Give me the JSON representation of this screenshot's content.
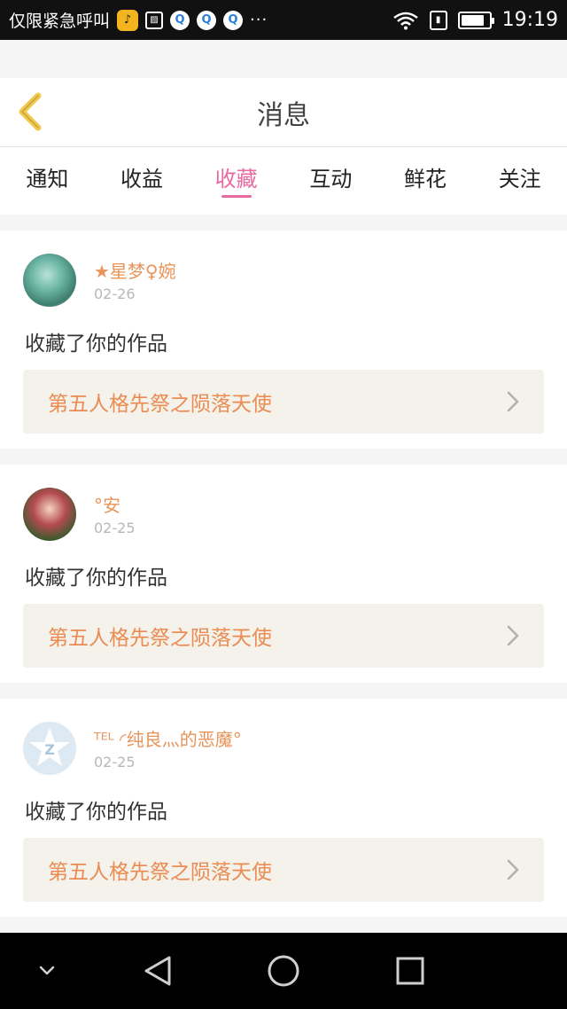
{
  "status_bar": {
    "carrier": "仅限紧急呼叫",
    "time": "19:19",
    "icons": [
      "music-app-icon",
      "gallery-icon",
      "qq-icon",
      "qq-icon",
      "qq-icon",
      "more-dots-icon",
      "wifi-icon",
      "sim-icon",
      "battery-icon"
    ],
    "dots": "···",
    "battery_level": 0.85
  },
  "header": {
    "title": "消息",
    "back_icon": "chevron-left-icon",
    "accent_color": "#f2c84b"
  },
  "tabs": [
    {
      "label": "通知",
      "active": false
    },
    {
      "label": "收益",
      "active": false
    },
    {
      "label": "收藏",
      "active": true
    },
    {
      "label": "互动",
      "active": false
    },
    {
      "label": "鲜花",
      "active": false
    },
    {
      "label": "关注",
      "active": false
    }
  ],
  "active_tab_color": "#e76aa2",
  "notifications": [
    {
      "user": "★星梦♀婉",
      "date": "02-26",
      "action": "收藏了你的作品",
      "work_title": "第五人格先祭之陨落天使"
    },
    {
      "user": "°安",
      "date": "02-25",
      "action": "收藏了你的作品",
      "work_title": "第五人格先祭之陨落天使"
    },
    {
      "user": "ᵀᴱᴸ ◜纯良灬的恶魔°",
      "date": "02-25",
      "action": "收藏了你的作品",
      "work_title": "第五人格先祭之陨落天使"
    }
  ],
  "name_color": "#e8945a",
  "work_title_color": "#ea8c53",
  "nav_bar": {
    "icons": [
      "chevron-down-icon",
      "back-triangle-icon",
      "home-circle-icon",
      "recents-square-icon"
    ]
  }
}
